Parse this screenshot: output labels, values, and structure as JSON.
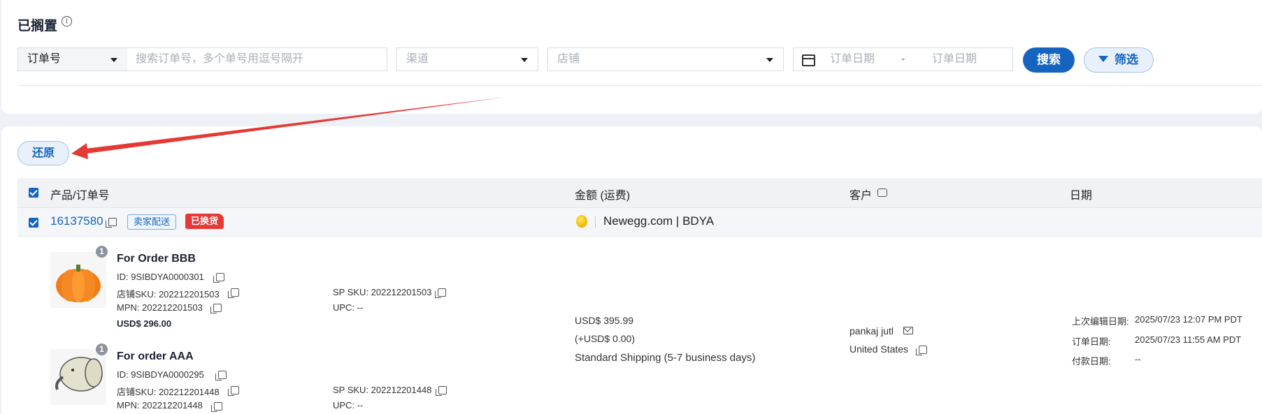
{
  "page": {
    "title": "已搁置"
  },
  "filters": {
    "search_type": "订单号",
    "search_placeholder": "搜索订单号，多个单号用逗号隔开",
    "channel_placeholder": "渠道",
    "store_placeholder": "店铺",
    "date_start_placeholder": "订单日期",
    "date_separator": "-",
    "date_end_placeholder": "订单日期",
    "search_button": "搜索",
    "filter_button": "筛选"
  },
  "actions": {
    "restore_button": "还原"
  },
  "table": {
    "headers": {
      "product": "产品/订单号",
      "amount": "金额 (运费)",
      "customer": "客户",
      "date": "日期"
    }
  },
  "order": {
    "id": "16137580",
    "tag_seller": "卖家配送",
    "tag_exchanged": "已换货",
    "channel": "Newegg.com | BDYA",
    "amount": "USD$ 395.99",
    "shipping_fee": "(+USD$ 0.00)",
    "shipping_method": "Standard Shipping (5-7 business days)",
    "customer_name": "pankaj jutl",
    "customer_country": "United States",
    "dates": [
      {
        "label": "上次编辑日期:",
        "value": "2025/07/23 12:07 PM PDT"
      },
      {
        "label": "订单日期:",
        "value": "2025/07/23 11:55 AM PDT"
      },
      {
        "label": "付款日期:",
        "value": "--"
      }
    ],
    "items": [
      {
        "qty": "1",
        "name": "For Order BBB",
        "id": "ID: 9SIBDYA0000301",
        "store_sku": "店铺SKU: 202212201503",
        "sp_sku": "SP SKU: 202212201503",
        "mpn": "MPN: 202212201503",
        "upc": "UPC: --",
        "price": "USD$ 296.00",
        "image": "pumpkin"
      },
      {
        "qty": "1",
        "name": "For order AAA",
        "id": "ID: 9SIBDYA0000295",
        "store_sku": "店铺SKU: 202212201448",
        "sp_sku": "SP SKU: 202212201448",
        "mpn": "MPN: 202212201448",
        "upc": "UPC: --",
        "image": "elephant"
      }
    ]
  },
  "colors": {
    "primary": "#1565c0",
    "danger": "#e53935",
    "arrow": "#e53935"
  }
}
